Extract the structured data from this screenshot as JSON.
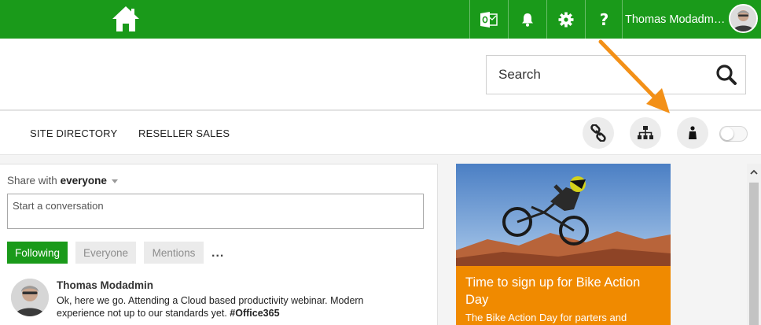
{
  "topbar": {
    "user_name": "Thomas Modadm…",
    "help_label": "?",
    "icons": [
      "home-icon",
      "outlook-icon",
      "bell-icon",
      "gear-icon",
      "help-icon",
      "avatar"
    ],
    "bg_color": "#1a9a1a"
  },
  "search": {
    "placeholder": "Search"
  },
  "nav": {
    "items": [
      {
        "label": "SITE DIRECTORY"
      },
      {
        "label": "RESELLER SALES"
      }
    ],
    "toolbar_icons": [
      "link-icon",
      "sitemap-icon",
      "person-icon",
      "toggle-switch"
    ]
  },
  "feed": {
    "share_prefix": "Share with",
    "share_target": "everyone",
    "conversation_placeholder": "Start a conversation",
    "tabs": [
      {
        "label": "Following",
        "active": true
      },
      {
        "label": "Everyone",
        "active": false
      },
      {
        "label": "Mentions",
        "active": false
      }
    ],
    "more_label": "...",
    "post": {
      "author": "Thomas Modadmin",
      "text": "Ok, here we go. Attending a Cloud based productivity webinar. Modern experience not up to our standards yet.",
      "hashtag": "#Office365"
    }
  },
  "promo": {
    "title": "Time to sign up for Bike Action Day",
    "description": "The Bike Action Day for parters and",
    "accent_color": "#f08a00"
  },
  "annotation": {
    "arrow_color": "#f08a00"
  }
}
